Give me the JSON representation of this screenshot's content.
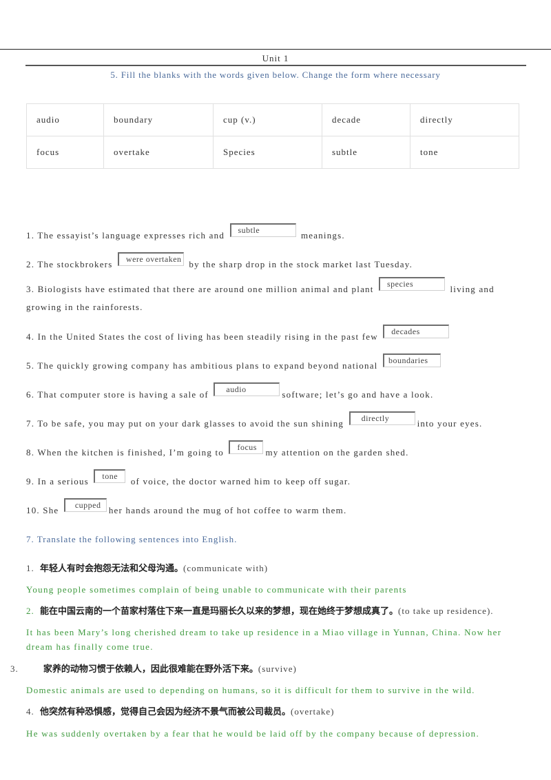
{
  "header": {
    "unit_title": "Unit 1",
    "section5_title": "5. Fill the blanks with the words given below. Change the form where necessary"
  },
  "word_table": {
    "rows": [
      [
        "audio",
        "boundary",
        "cup (v.)",
        "decade",
        "directly"
      ],
      [
        "focus",
        "overtake",
        "Species",
        "subtle",
        "tone"
      ]
    ]
  },
  "fill_blanks": [
    {
      "before": "1. The essayist’s language expresses rich and",
      "answer": "subtle",
      "after": "meanings."
    },
    {
      "before": "2. The stockbrokers",
      "answer": "were overtaken",
      "after": "by the sharp drop in the stock market last Tuesday."
    },
    {
      "before": "3. Biologists have estimated that there are around one million animal and plant",
      "answer": "species",
      "after": "living and growing in the rainforests."
    },
    {
      "before": "4. In the United States the cost of living has been steadily rising in the past few",
      "answer": "decades",
      "after": ""
    },
    {
      "before": "5. The quickly growing company has ambitious plans to expand beyond national",
      "answer": "boundaries",
      "after": ""
    },
    {
      "before": "6. That computer store is having a sale of",
      "answer": "audio",
      "after": "software; let’s go and have a look."
    },
    {
      "before": "7. To be safe, you may put on your dark glasses to avoid the sun shining",
      "answer": "directly",
      "after": "into your eyes."
    },
    {
      "before": "8. When the kitchen is finished, I’m going to",
      "answer": "focus",
      "after": "my attention on the garden shed."
    },
    {
      "before": "9. In a serious",
      "answer": "tone",
      "after": "of voice, the doctor warned him to keep off sugar."
    },
    {
      "before": "10. She",
      "answer": "cupped",
      "after": "her hands around the mug of hot coffee to warm them."
    }
  ],
  "translation": {
    "title": "7. Translate the following sentences into English.",
    "items": [
      {
        "num": "1.",
        "chinese": "年轻人有时会抱怨无法和父母沟通。",
        "hint": "(communicate with)",
        "english": "Young people sometimes complain of being unable to communicate with their parents"
      },
      {
        "num": "2.",
        "chinese": "能在中国云南的一个苗家村落住下来一直是玛丽长久以来的梦想，现在她终于梦想成真了。",
        "hint": "(to take up residence).",
        "english": "It has been Mary’s long cherished dream to take up residence in a Miao village in Yunnan, China. Now her dream has finally come true."
      },
      {
        "num": "3.",
        "chinese": "家养的动物习惯于依赖人，因此很难能在野外活下来。",
        "hint": "(survive)",
        "english": "Domestic animals are used to depending on humans, so it is difficult for them to survive in the wild."
      },
      {
        "num": "4.",
        "chinese": "他突然有种恐惧感，觉得自己会因为经济不景气而被公司裁员。",
        "hint": "(overtake)",
        "english": "He was suddenly overtaken by a fear that he would be laid off by the company because of depression."
      }
    ]
  },
  "colors": {
    "heading_blue": "#4a6a9a",
    "answer_green": "#3f9a3f"
  }
}
